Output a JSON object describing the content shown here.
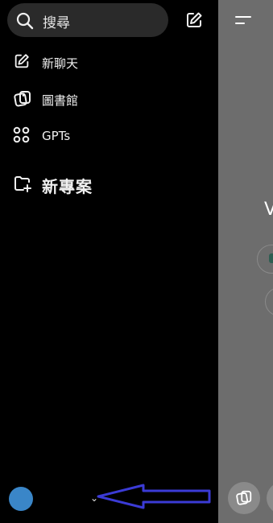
{
  "search": {
    "placeholder": "搜尋"
  },
  "nav": [
    {
      "label": "新聊天",
      "icon": "edit-icon"
    },
    {
      "label": "圖書館",
      "icon": "library-icon"
    },
    {
      "label": "GPTs",
      "icon": "grid-dots-icon"
    }
  ],
  "projects": {
    "label": "新專案",
    "icon": "folder-plus-icon"
  },
  "account": {
    "chevron": "⌄"
  },
  "main": {
    "letter": "V"
  },
  "colors": {
    "sidebar_bg": "#000000",
    "search_bg": "#2a2a2a",
    "main_bg": "#6d6d6d",
    "avatar": "#3a86c8",
    "arrow": "#3b3bd6"
  }
}
